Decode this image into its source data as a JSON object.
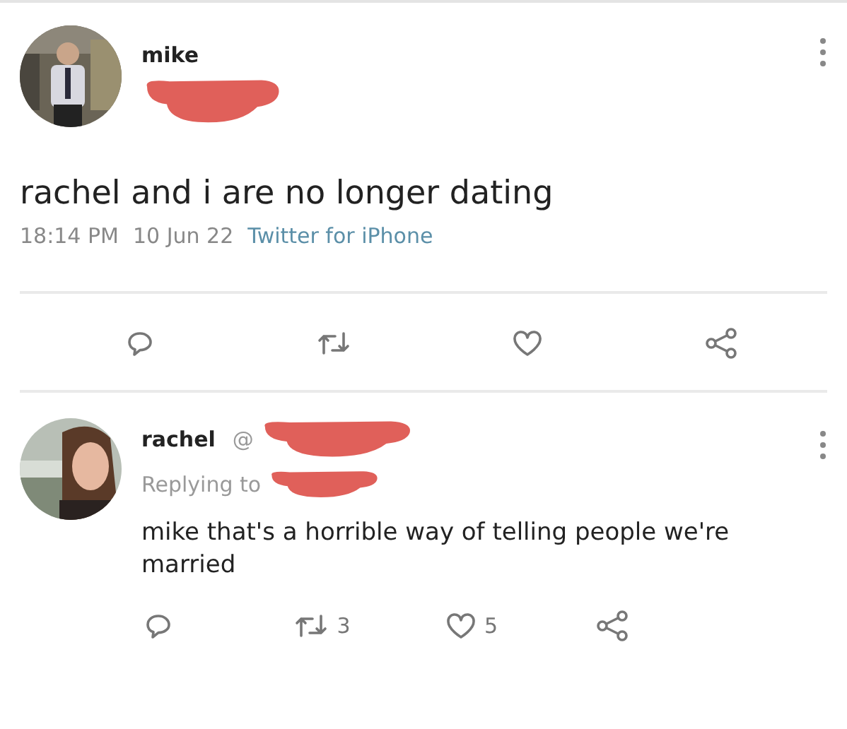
{
  "tweet": {
    "author": "mike",
    "handle_redacted": true,
    "text": "rachel and i are no longer dating",
    "time": "18:14 PM",
    "date": "10 Jun 22",
    "source": "Twitter for iPhone",
    "actions": [
      {
        "kind": "reply"
      },
      {
        "kind": "retweet"
      },
      {
        "kind": "like"
      },
      {
        "kind": "share"
      }
    ]
  },
  "reply": {
    "author": "rachel",
    "handle_prefix": "@",
    "replying_to": "Replying to",
    "text": "mike that's a horrible way of telling people we're married",
    "actions": [
      {
        "kind": "reply"
      },
      {
        "kind": "retweet",
        "count": "3"
      },
      {
        "kind": "like",
        "count": "5"
      },
      {
        "kind": "share"
      }
    ]
  }
}
